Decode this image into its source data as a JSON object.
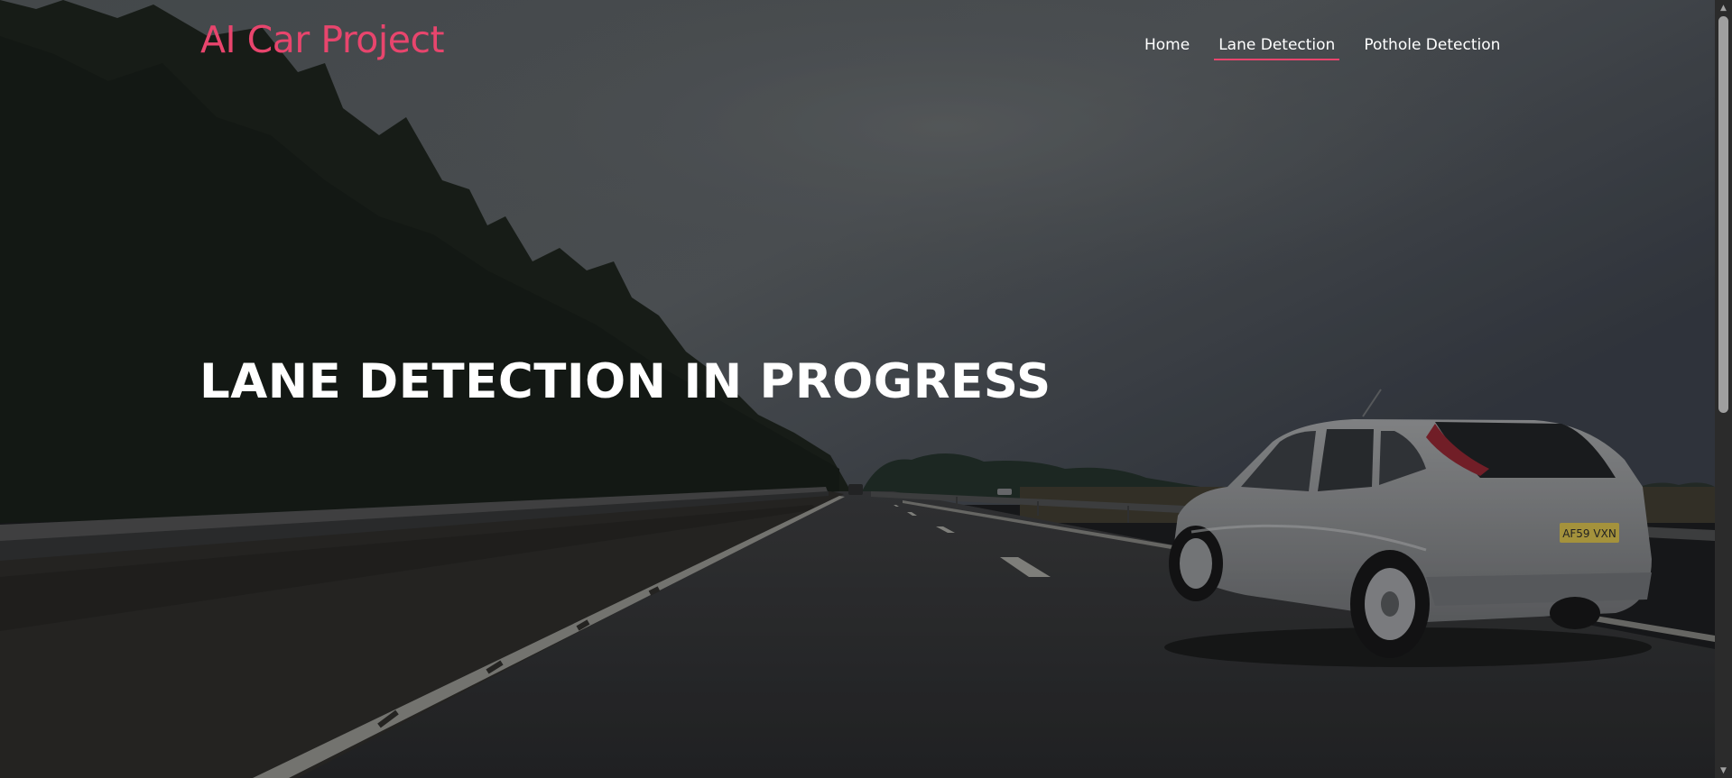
{
  "header": {
    "brand": "AI Car Project",
    "nav": [
      {
        "label": "Home",
        "active": false
      },
      {
        "label": "Lane Detection",
        "active": true
      },
      {
        "label": "Pothole Detection",
        "active": false
      }
    ]
  },
  "hero": {
    "title": "LANE DETECTION IN PROGRESS",
    "plate_text": "AF59 VXN"
  },
  "colors": {
    "accent": "#e8456d",
    "text": "#ffffff",
    "scrollbar_track": "#2b2b2b",
    "scrollbar_thumb": "#9f9f9f"
  },
  "icons": {
    "scroll_up": "scroll-up-arrow-icon",
    "scroll_down": "scroll-down-arrow-icon"
  }
}
